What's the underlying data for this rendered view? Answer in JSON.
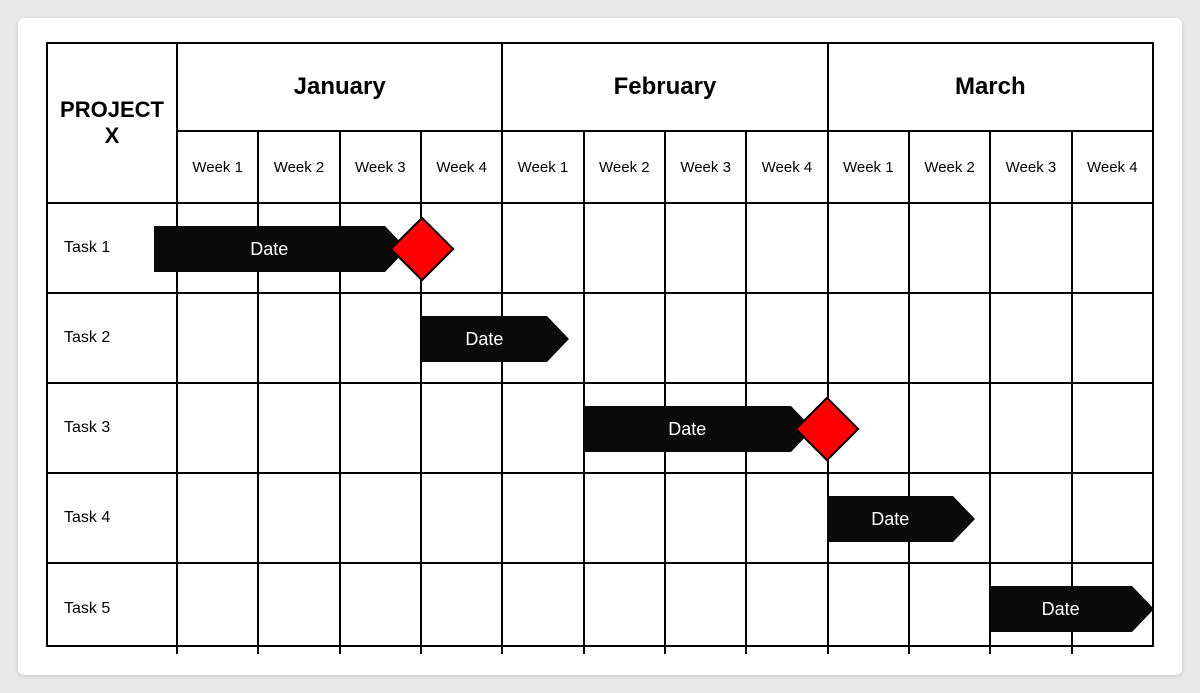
{
  "title": "PROJECT\nX",
  "months": [
    "January",
    "February",
    "March"
  ],
  "weeks": [
    "Week 1",
    "Week 2",
    "Week 3",
    "Week 4"
  ],
  "tasks": [
    "Task 1",
    "Task 2",
    "Task 3",
    "Task 4",
    "Task 5"
  ],
  "bar_label": "Date",
  "colors": {
    "bar": "#0a0a0a",
    "milestone": "#ff0000"
  },
  "chart_data": {
    "type": "bar",
    "title": "PROJECT X",
    "xlabel": "",
    "ylabel": "",
    "x_units": "week index (0 = Jan Week 1, 11 = Mar Week 4)",
    "categories": [
      "Task 1",
      "Task 2",
      "Task 3",
      "Task 4",
      "Task 5"
    ],
    "series": [
      {
        "name": "Task 1",
        "start": -0.3,
        "end": 2.8,
        "label": "Date"
      },
      {
        "name": "Task 2",
        "start": 3.0,
        "end": 4.8,
        "label": "Date"
      },
      {
        "name": "Task 3",
        "start": 5.0,
        "end": 7.8,
        "label": "Date"
      },
      {
        "name": "Task 4",
        "start": 8.0,
        "end": 9.8,
        "label": "Date"
      },
      {
        "name": "Task 5",
        "start": 10.0,
        "end": 12.0,
        "label": "Date"
      }
    ],
    "milestones": [
      {
        "task": "Task 1",
        "x": 3.0
      },
      {
        "task": "Task 3",
        "x": 8.0
      }
    ],
    "xticks_major": [
      "January",
      "February",
      "March"
    ],
    "xticks_minor": [
      "Week 1",
      "Week 2",
      "Week 3",
      "Week 4",
      "Week 1",
      "Week 2",
      "Week 3",
      "Week 4",
      "Week 1",
      "Week 2",
      "Week 3",
      "Week 4"
    ],
    "xlim": [
      0,
      12
    ]
  }
}
